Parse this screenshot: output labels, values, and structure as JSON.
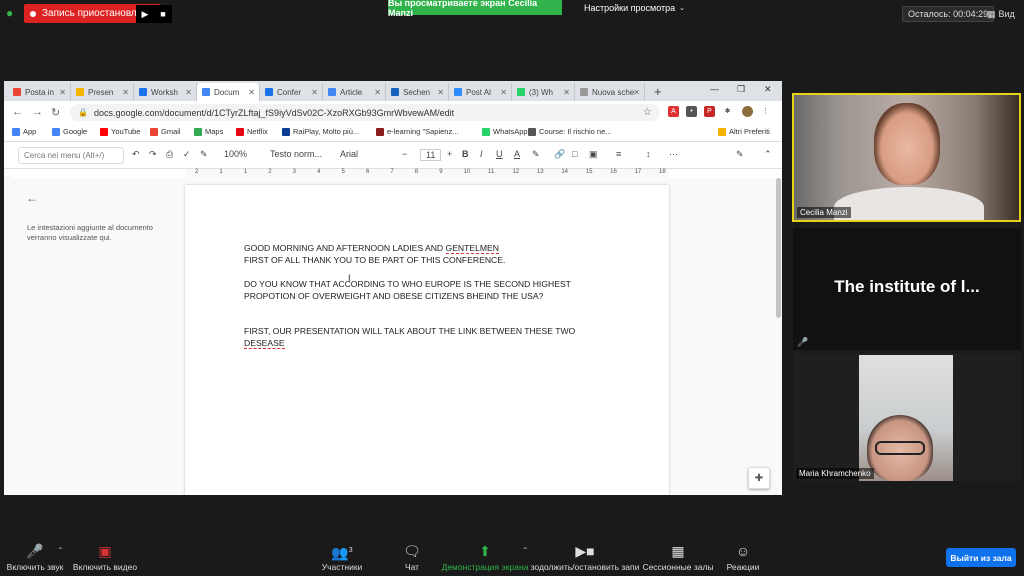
{
  "zoom_top": {
    "recording_label": "Запись приостановлена",
    "viewing_banner": "Вы просматриваете экран Cecilia Manzi",
    "view_settings": "Настройки просмотра",
    "remaining": "Осталось: 00:04:29",
    "view": "Вид"
  },
  "browser": {
    "tabs": [
      {
        "label": "Posta in",
        "color": "#ea4335"
      },
      {
        "label": "Presen",
        "color": "#f4b400"
      },
      {
        "label": "Worksh",
        "color": "#1a73e8"
      },
      {
        "label": "Docum",
        "color": "#4285f4"
      },
      {
        "label": "Confer",
        "color": "#1a73e8"
      },
      {
        "label": "Article",
        "color": "#4285f4"
      },
      {
        "label": "Sechen",
        "color": "#1565c0"
      },
      {
        "label": "Post Al",
        "color": "#2d8cff"
      },
      {
        "label": "(3) Wh",
        "color": "#25d366"
      },
      {
        "label": "Nuova sche",
        "color": "#999999"
      }
    ],
    "url": "docs.google.com/document/d/1CTyrZLftaj_fS9iyVdSv02C-XzoRXGb93GmrWbvewAM/edit",
    "bookmarks": [
      {
        "label": "App",
        "color": "#4285f4"
      },
      {
        "label": "Google",
        "color": "#4285f4"
      },
      {
        "label": "YouTube",
        "color": "#ff0000"
      },
      {
        "label": "Gmail",
        "color": "#ea4335"
      },
      {
        "label": "Maps",
        "color": "#34a853"
      },
      {
        "label": "Netflix",
        "color": "#e50914"
      },
      {
        "label": "RaiPlay, Molto più...",
        "color": "#0a3d91"
      },
      {
        "label": "e-learning \"Sapienz...",
        "color": "#8a1c1c"
      },
      {
        "label": "WhatsApp",
        "color": "#25d366"
      },
      {
        "label": "Course: Il rischio ne...",
        "color": "#555555"
      }
    ],
    "other_bookmarks": "Altri Preferiti"
  },
  "docs": {
    "menu_search_placeholder": "Cerca nei menu (Alt+/)",
    "zoom": "100%",
    "style": "Testo norm...",
    "font": "Arial",
    "font_size": "11",
    "ruler_labels": [
      "2",
      "1",
      "1",
      "2",
      "3",
      "4",
      "5",
      "6",
      "7",
      "8",
      "9",
      "10",
      "11",
      "12",
      "13",
      "14",
      "15",
      "16",
      "17",
      "18"
    ],
    "outline_note": "Le intestazioni aggiunte al documento verranno visualizzate qui.",
    "lines": [
      "GOOD MORNING AND AFTERNOON LADIES AND ",
      "GENTELMEN",
      "FIRST OF ALL THANK YOU TO BE PART OF THIS CONFERENCE.",
      "DO YOU KNOW THAT ACCORDING TO WHO EUROPE IS THE SECOND HIGHEST",
      "PROPOTION OF OVERWEIGHT AND OBESE CITIZENS BHEIND THE USA?",
      "FIRST, OUR PRESENTATION WILL TALK ABOUT THE LINK BETWEEN THESE TWO",
      "DESEASE"
    ]
  },
  "participants": {
    "speaker_name": "Cecilia Manzi",
    "institute_title": "The institute of l...",
    "maria_name": "Maria Khramchenko"
  },
  "bottom": {
    "unmute": "Включить звук",
    "video": "Включить видео",
    "participants": "Участники",
    "participants_count": "3",
    "chat": "Чат",
    "share": "Демонстрация экрана",
    "record": "зодолжить/остановить запи",
    "breakout": "Сессионные залы",
    "reactions": "Реакции",
    "leave": "Выйти из зала"
  }
}
